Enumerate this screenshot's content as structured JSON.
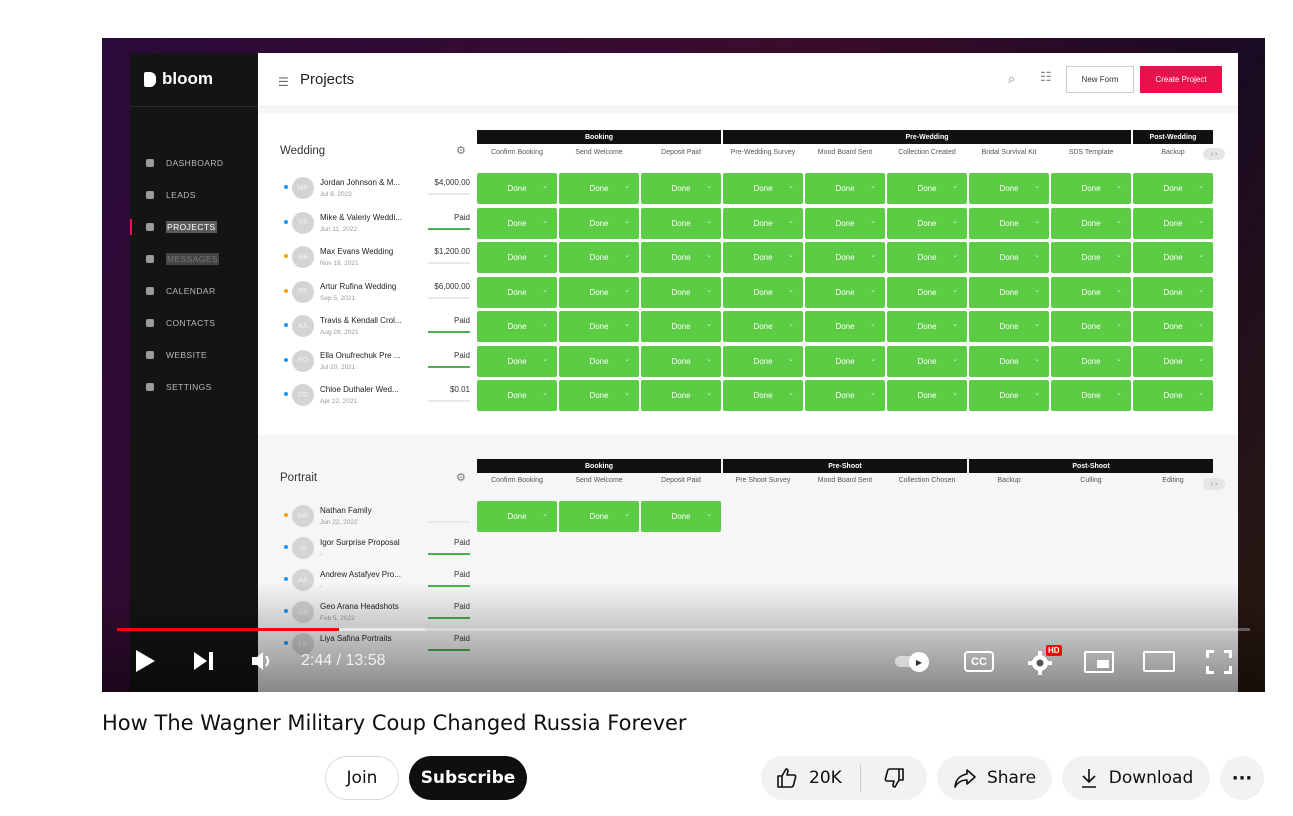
{
  "video": {
    "time": "2:44 / 13:58",
    "progress_played": 0.196,
    "progress_buffered": 0.272,
    "hd_badge": "HD",
    "cc_label": "CC"
  },
  "app": {
    "logo": "bloom",
    "page_title": "Projects",
    "new_form": "New Form",
    "create_project": "Create Project",
    "nav": [
      {
        "label": "DASHBOARD",
        "icon": "dashboard-icon"
      },
      {
        "label": "LEADS",
        "icon": "filter-icon"
      },
      {
        "label": "PROJECTS",
        "icon": "briefcase-icon"
      },
      {
        "label": "MESSAGES",
        "icon": "message-icon"
      },
      {
        "label": "CALENDAR",
        "icon": "calendar-icon"
      },
      {
        "label": "CONTACTS",
        "icon": "person-icon"
      },
      {
        "label": "WEBSITE",
        "icon": "website-icon"
      },
      {
        "label": "SETTINGS",
        "icon": "gear-icon"
      }
    ],
    "wedding": {
      "title": "Wedding",
      "groups": [
        "Booking",
        "Pre-Wedding",
        "Post-Wedding"
      ],
      "columns": [
        "Confirm Booking",
        "Send Welcome",
        "Deposit Paid",
        "Pre-Wedding Survey",
        "Mood Board Sent",
        "Collection Created",
        "Bridal Survival Kit",
        "SDS Template",
        "Backup"
      ],
      "rows": [
        {
          "initials": "MP",
          "name": "Jordan Johnson & M...",
          "date": "Jul 8, 2023",
          "amount": "$4,000.00",
          "paid": 0.0,
          "dot": "#2196f3"
        },
        {
          "initials": "VS",
          "name": "Mike & Valeriy Weddi...",
          "date": "Jun 11, 2022",
          "amount": "Paid",
          "paid": 1.0,
          "dot": "#2196f3"
        },
        {
          "initials": "ME",
          "name": "Max Evans Wedding",
          "date": "Nov 18, 2021",
          "amount": "$1,200.00",
          "paid": 0.0,
          "dot": "#f0a500"
        },
        {
          "initials": "RK",
          "name": "Artur Rufina Wedding",
          "date": "Sep 5, 2021",
          "amount": "$6,000.00",
          "paid": 0.0,
          "dot": "#f0a500"
        },
        {
          "initials": "KA",
          "name": "Travis & Kendall Crol...",
          "date": "Aug 28, 2021",
          "amount": "Paid",
          "paid": 1.0,
          "dot": "#2196f3"
        },
        {
          "initials": "EO",
          "name": "Ella Onufrechuk Pre ...",
          "date": "Jul 20, 2021",
          "amount": "Paid",
          "paid": 1.0,
          "dot": "#2196f3"
        },
        {
          "initials": "CD",
          "name": "Chloe Duthaler Wed...",
          "date": "Apr 22, 2021",
          "amount": "$0.01",
          "paid": 0.0,
          "dot": "#2196f3"
        }
      ],
      "cell_label": "Done"
    },
    "portrait": {
      "title": "Portrait",
      "groups": [
        "Booking",
        "Pre-Shoot",
        "Post-Shoot"
      ],
      "columns": [
        "Confirm Booking",
        "Send Welcome",
        "Deposit Paid",
        "Pre Shoot Survey",
        "Mood Board Sent",
        "Collection Chosen",
        "Backup",
        "Culling",
        "Editing"
      ],
      "rows": [
        {
          "initials": "NR",
          "name": "Nathan Family",
          "date": "Jun 22, 2022",
          "amount": "",
          "paid": 0.0,
          "dot": "#f0a500"
        },
        {
          "initials": "IS",
          "name": "Igor Surprise Proposal",
          "date": "-",
          "amount": "Paid",
          "paid": 1.0,
          "dot": "#2196f3"
        },
        {
          "initials": "AA",
          "name": "Andrew Astafyev Pro...",
          "date": "-",
          "amount": "Paid",
          "paid": 1.0,
          "dot": "#2196f3"
        },
        {
          "initials": "GA",
          "name": "Geo Arana Headshots",
          "date": "Feb 5, 2022",
          "amount": "Paid",
          "paid": 1.0,
          "dot": "#2196f3"
        },
        {
          "initials": "LS",
          "name": "Liya Safina Portraits",
          "date": "",
          "amount": "Paid",
          "paid": 1.0,
          "dot": "#2196f3"
        }
      ],
      "done_cells": 3,
      "cell_label": "Done"
    }
  },
  "meta": {
    "title": "How The Wagner Military Coup Changed Russia Forever",
    "join": "Join",
    "subscribe": "Subscribe",
    "likes": "20K",
    "share": "Share",
    "download": "Download",
    "more": "···"
  }
}
